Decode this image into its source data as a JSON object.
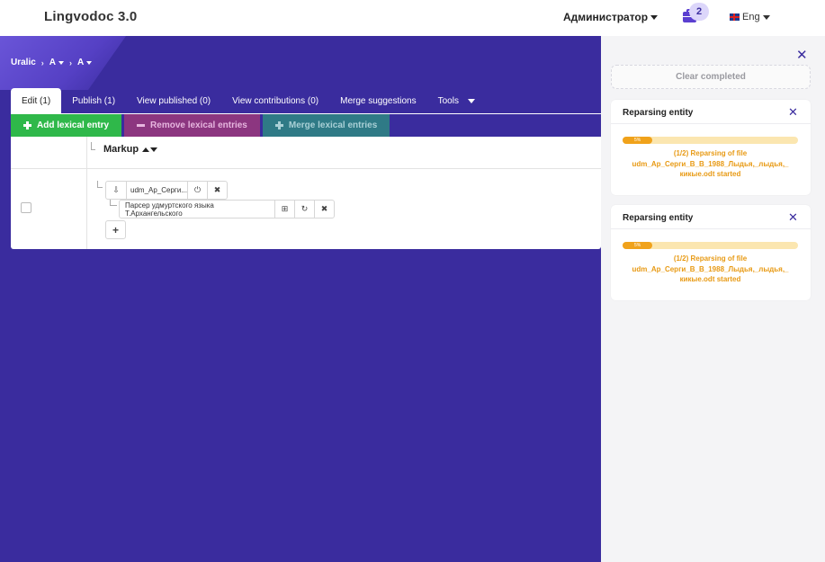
{
  "header": {
    "brand": "Lingvodoc 3.0",
    "user": "Администратор",
    "tasks_count": "2",
    "language": "Eng"
  },
  "breadcrumb": {
    "items": [
      "Uralic",
      "A",
      "A"
    ]
  },
  "tabs": [
    {
      "label": "Edit (1)",
      "active": true
    },
    {
      "label": "Publish (1)"
    },
    {
      "label": "View published (0)"
    },
    {
      "label": "View contributions (0)"
    },
    {
      "label": "Merge suggestions"
    },
    {
      "label": "Tools"
    }
  ],
  "actions": {
    "add": "Add lexical entry",
    "remove": "Remove lexical entries",
    "merge": "Merge lexical entries"
  },
  "table": {
    "column_markup": "Markup",
    "entry": {
      "file_name": "udm_Ap_Серги...",
      "parser_name": "Парсер удмуртского языка Т.Архангельского"
    }
  },
  "panel": {
    "clear_completed": "Clear completed",
    "tasks": [
      {
        "title": "Reparsing entity",
        "progress": 5,
        "progress_label": "5%",
        "message_lines": [
          "(1/2) Reparsing of file",
          "udm_Ap_Серги_В_В_1988_Лыдья,_лыдья,_",
          "кикые.odt started"
        ]
      },
      {
        "title": "Reparsing entity",
        "progress": 5,
        "progress_label": "5%",
        "message_lines": [
          "(1/2) Reparsing of file",
          "udm_Ap_Серги_В_В_1988_Лыдья,_лыдья,_",
          "кикые.odt started"
        ]
      }
    ]
  },
  "colors": {
    "background": "#3a2c9e",
    "add_button": "#2fb84a",
    "remove_button": "#8c3680",
    "merge_button": "#2f7a86",
    "progress": "#f0a21b"
  }
}
